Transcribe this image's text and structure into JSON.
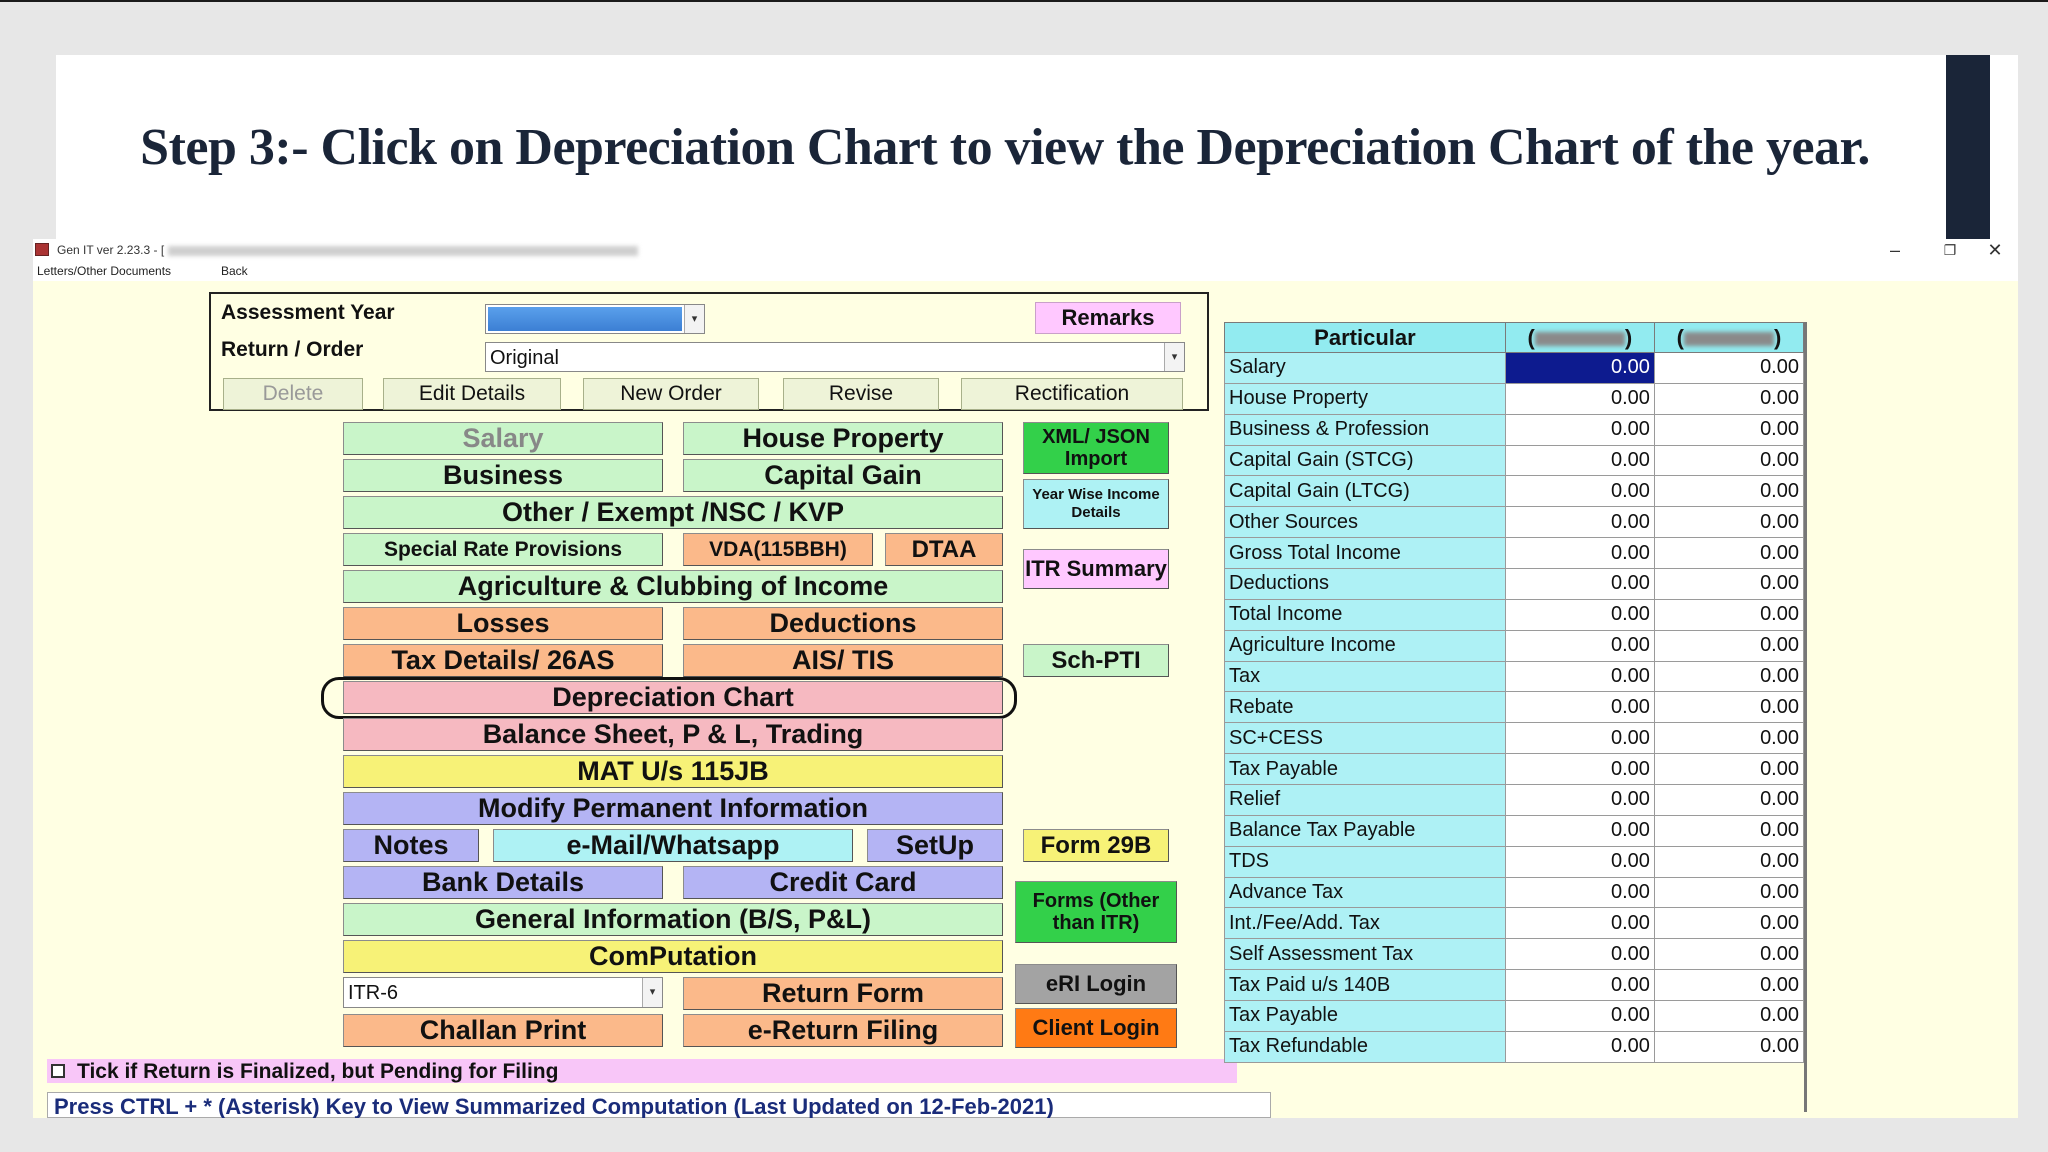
{
  "slide": {
    "title": "Step 3:- Click on Depreciation Chart to view the Depreciation Chart of the year."
  },
  "window": {
    "title": "Gen IT ver 2.23.3 - [",
    "controls": {
      "minimize": "–",
      "maximize": "❐",
      "close": "✕"
    }
  },
  "menu": {
    "items": [
      "Letters/Other Documents",
      "Back"
    ]
  },
  "assessment": {
    "year_label": "Assessment Year",
    "year_value": "",
    "return_label": "Return / Order",
    "return_value": "Original",
    "remarks_label": "Remarks",
    "actions": {
      "delete": "Delete",
      "edit": "Edit Details",
      "new_order": "New Order",
      "revise": "Revise",
      "rectification": "Rectification"
    }
  },
  "buttons": {
    "salary": "Salary",
    "house_property": "House Property",
    "business": "Business",
    "capital_gain": "Capital Gain",
    "other_exempt": "Other / Exempt /NSC / KVP",
    "special_rate": "Special Rate Provisions",
    "vda": "VDA(115BBH)",
    "dtaa": "DTAA",
    "agriculture": "Agriculture & Clubbing of Income",
    "losses": "Losses",
    "deductions": "Deductions",
    "tax_details": "Tax Details/ 26AS",
    "ais_tis": "AIS/ TIS",
    "depreciation_chart": "Depreciation Chart",
    "balance_sheet": "Balance Sheet, P & L, Trading",
    "mat": "MAT U/s 115JB",
    "modify_info": "Modify Permanent Information",
    "notes": "Notes",
    "email": "e-Mail/Whatsapp",
    "setup": "SetUp",
    "bank_details": "Bank Details",
    "credit_card": "Credit Card",
    "general_info": "General Information (B/S, P&L)",
    "computation": "ComPutation",
    "itr_form": "ITR-6",
    "return_form": "Return Form",
    "challan_print": "Challan Print",
    "e_return_filing": "e-Return Filing",
    "xml_import_1": "XML/ JSON",
    "xml_import_2": "Import",
    "year_wise_1": "Year Wise Income",
    "year_wise_2": "Details",
    "itr_summary": "ITR Summary",
    "sch_pti": "Sch-PTI",
    "form_29b": "Form 29B",
    "forms_other_1": "Forms (Other",
    "forms_other_2": "than ITR)",
    "eri_login": "eRI Login",
    "client_login": "Client Login"
  },
  "footer": {
    "finalize_text": "Tick if Return is Finalized, but Pending for Filing",
    "hint_text": "Press CTRL + * (Asterisk) Key to View Summarized Computation (Last Updated on 12-Feb-2021)"
  },
  "summary": {
    "header_particular": "Particular",
    "header_col1": "(",
    "header_col2": ")",
    "rows": [
      {
        "label": "Salary",
        "v1": "0.00",
        "v2": "0.00"
      },
      {
        "label": "House Property",
        "v1": "0.00",
        "v2": "0.00"
      },
      {
        "label": "Business & Profession",
        "v1": "0.00",
        "v2": "0.00"
      },
      {
        "label": "Capital Gain (STCG)",
        "v1": "0.00",
        "v2": "0.00"
      },
      {
        "label": "Capital Gain (LTCG)",
        "v1": "0.00",
        "v2": "0.00"
      },
      {
        "label": "Other Sources",
        "v1": "0.00",
        "v2": "0.00"
      },
      {
        "label": "Gross Total Income",
        "v1": "0.00",
        "v2": "0.00"
      },
      {
        "label": "Deductions",
        "v1": "0.00",
        "v2": "0.00"
      },
      {
        "label": "Total Income",
        "v1": "0.00",
        "v2": "0.00"
      },
      {
        "label": "Agriculture Income",
        "v1": "0.00",
        "v2": "0.00"
      },
      {
        "label": "Tax",
        "v1": "0.00",
        "v2": "0.00"
      },
      {
        "label": "Rebate",
        "v1": "0.00",
        "v2": "0.00"
      },
      {
        "label": "SC+CESS",
        "v1": "0.00",
        "v2": "0.00"
      },
      {
        "label": "Tax Payable",
        "v1": "0.00",
        "v2": "0.00"
      },
      {
        "label": "Relief",
        "v1": "0.00",
        "v2": "0.00"
      },
      {
        "label": "Balance Tax Payable",
        "v1": "0.00",
        "v2": "0.00"
      },
      {
        "label": "TDS",
        "v1": "0.00",
        "v2": "0.00"
      },
      {
        "label": "Advance Tax",
        "v1": "0.00",
        "v2": "0.00"
      },
      {
        "label": "Int./Fee/Add. Tax",
        "v1": "0.00",
        "v2": "0.00"
      },
      {
        "label": "Self Assessment Tax",
        "v1": "0.00",
        "v2": "0.00"
      },
      {
        "label": "Tax Paid u/s 140B",
        "v1": "0.00",
        "v2": "0.00"
      },
      {
        "label": "Tax Payable",
        "v1": "0.00",
        "v2": "0.00"
      },
      {
        "label": "Tax Refundable",
        "v1": "0.00",
        "v2": "0.00"
      }
    ]
  },
  "colors": {
    "app_background": "#ffffe3",
    "slide_title": "#1a2538",
    "highlight_cell": "#0d1b8f"
  }
}
